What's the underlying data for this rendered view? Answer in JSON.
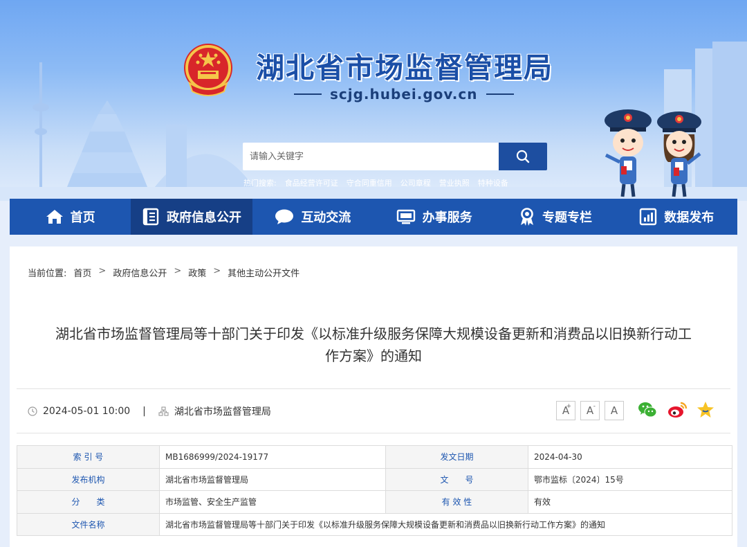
{
  "header": {
    "title": "湖北省市场监督管理局",
    "domain": "scjg.hubei.gov.cn",
    "search_placeholder": "请输入关键字",
    "hot_label": "热门搜索:",
    "hot_keywords": [
      "食品经营许可证",
      "守合同重信用",
      "公司章程",
      "营业执照",
      "特种设备"
    ]
  },
  "nav": {
    "items": [
      {
        "label": "首页",
        "icon": "home-icon"
      },
      {
        "label": "政府信息公开",
        "icon": "document-list-icon"
      },
      {
        "label": "互动交流",
        "icon": "chat-bubble-icon"
      },
      {
        "label": "办事服务",
        "icon": "monitor-icon"
      },
      {
        "label": "专题专栏",
        "icon": "award-ribbon-icon"
      },
      {
        "label": "数据发布",
        "icon": "bar-chart-icon"
      }
    ],
    "active_index": 1
  },
  "breadcrumb": {
    "label": "当前位置:",
    "items": [
      "首页",
      "政府信息公开",
      "政策",
      "其他主动公开文件"
    ],
    "separator": ">"
  },
  "article": {
    "title_line1": "湖北省市场监督管理局等十部门关于印发《以标准升级服务保障大规模设备更新和消费品以旧换新行动工",
    "title_line2": "作方案》的通知",
    "date": "2024-05-01 10:00",
    "meta_separator": "|",
    "source": "湖北省市场监督管理局"
  },
  "font_controls": {
    "larger": "A",
    "larger_sup": "+",
    "smaller": "A",
    "smaller_sup": "-",
    "reset": "A"
  },
  "info_table": {
    "row1": {
      "l1": "索 引 号",
      "v1": "MB1686999/2024-19177",
      "l2": "发文日期",
      "v2": "2024-04-30"
    },
    "row2": {
      "l1": "发布机构",
      "v1": "湖北省市场监督管理局",
      "l2": "文　　号",
      "v2": "鄂市监标〔2024〕15号"
    },
    "row3": {
      "l1": "分　　类",
      "v1": "市场监管、安全生产监管",
      "l2": "有 效 性",
      "v2": "有效"
    },
    "row4": {
      "l1": "文件名称",
      "v1": "湖北省市场监督管理局等十部门关于印发《以标准升级服务保障大规模设备更新和消费品以旧换新行动工作方案》的通知"
    }
  },
  "colors": {
    "nav_bg": "#1d56b0",
    "nav_active": "#163f86",
    "title_blue": "#1b4fa7",
    "label_blue": "#1d56b0"
  }
}
